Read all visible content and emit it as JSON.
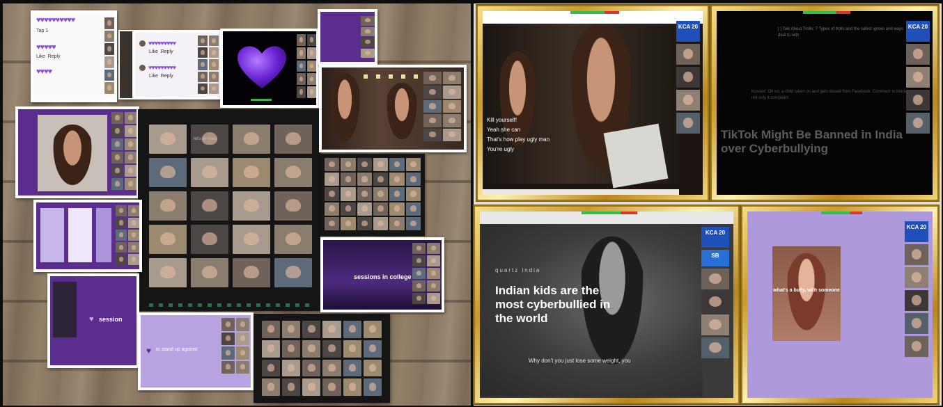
{
  "collage": {
    "hearts_card": {
      "rows": [
        "♥♥♥♥♥♥♥♥♥♥",
        "♥♥♥♥♥",
        "♥♥♥♥"
      ],
      "labels": [
        "Tap 1",
        "Like",
        "Reply",
        "Like",
        "Tap"
      ]
    },
    "profile_card": {
      "rows": [
        "♥♥♥♥♥♥♥♥♥",
        "♥♥♥♥♥♥♥♥♥"
      ],
      "labels": [
        "Like",
        "Reply",
        "Like",
        "Reply"
      ]
    },
    "big_heart_caption": "",
    "cards_text": {
      "sessions_title": "sessions in college",
      "session_label": "session",
      "in_stand_up": "to stand up against"
    },
    "grid_card_title": "let's be there"
  },
  "frames": {
    "f1": {
      "badge": "KCA 20",
      "chat": [
        "Kill yourself!",
        "Yeah she can",
        "That's how play ugly man",
        "You're ugly"
      ]
    },
    "f2": {
      "badge": "KCA 20",
      "header_text": "[ ] Talk About Trolls: 7 Types of trolls and the safest ignore and ways deal to with",
      "body_text": "Kosovo: Oh no, a child taken on and gets dissed from Facebook. Comment to block not only it complaint",
      "headline": "TikTok Might Be Banned in India over Cyberbullying"
    },
    "f3": {
      "badge": "KCA 20",
      "cam_label": "SB",
      "brand": "quartz  india",
      "headline": "Indian kids are the most cyberbullied in the world",
      "subtitle": "Why don't you just lose some weight, you"
    },
    "f4": {
      "badge": "KCA 20",
      "caption": "what's a bully, with someone"
    }
  },
  "colors": {
    "violet": "#5a2d8e",
    "lilac": "#b7a3e0",
    "gold": "#c99a2e",
    "kca_blue": "#1f4fb8"
  },
  "icons": [
    "heart-icon",
    "purple-heart-icon"
  ]
}
